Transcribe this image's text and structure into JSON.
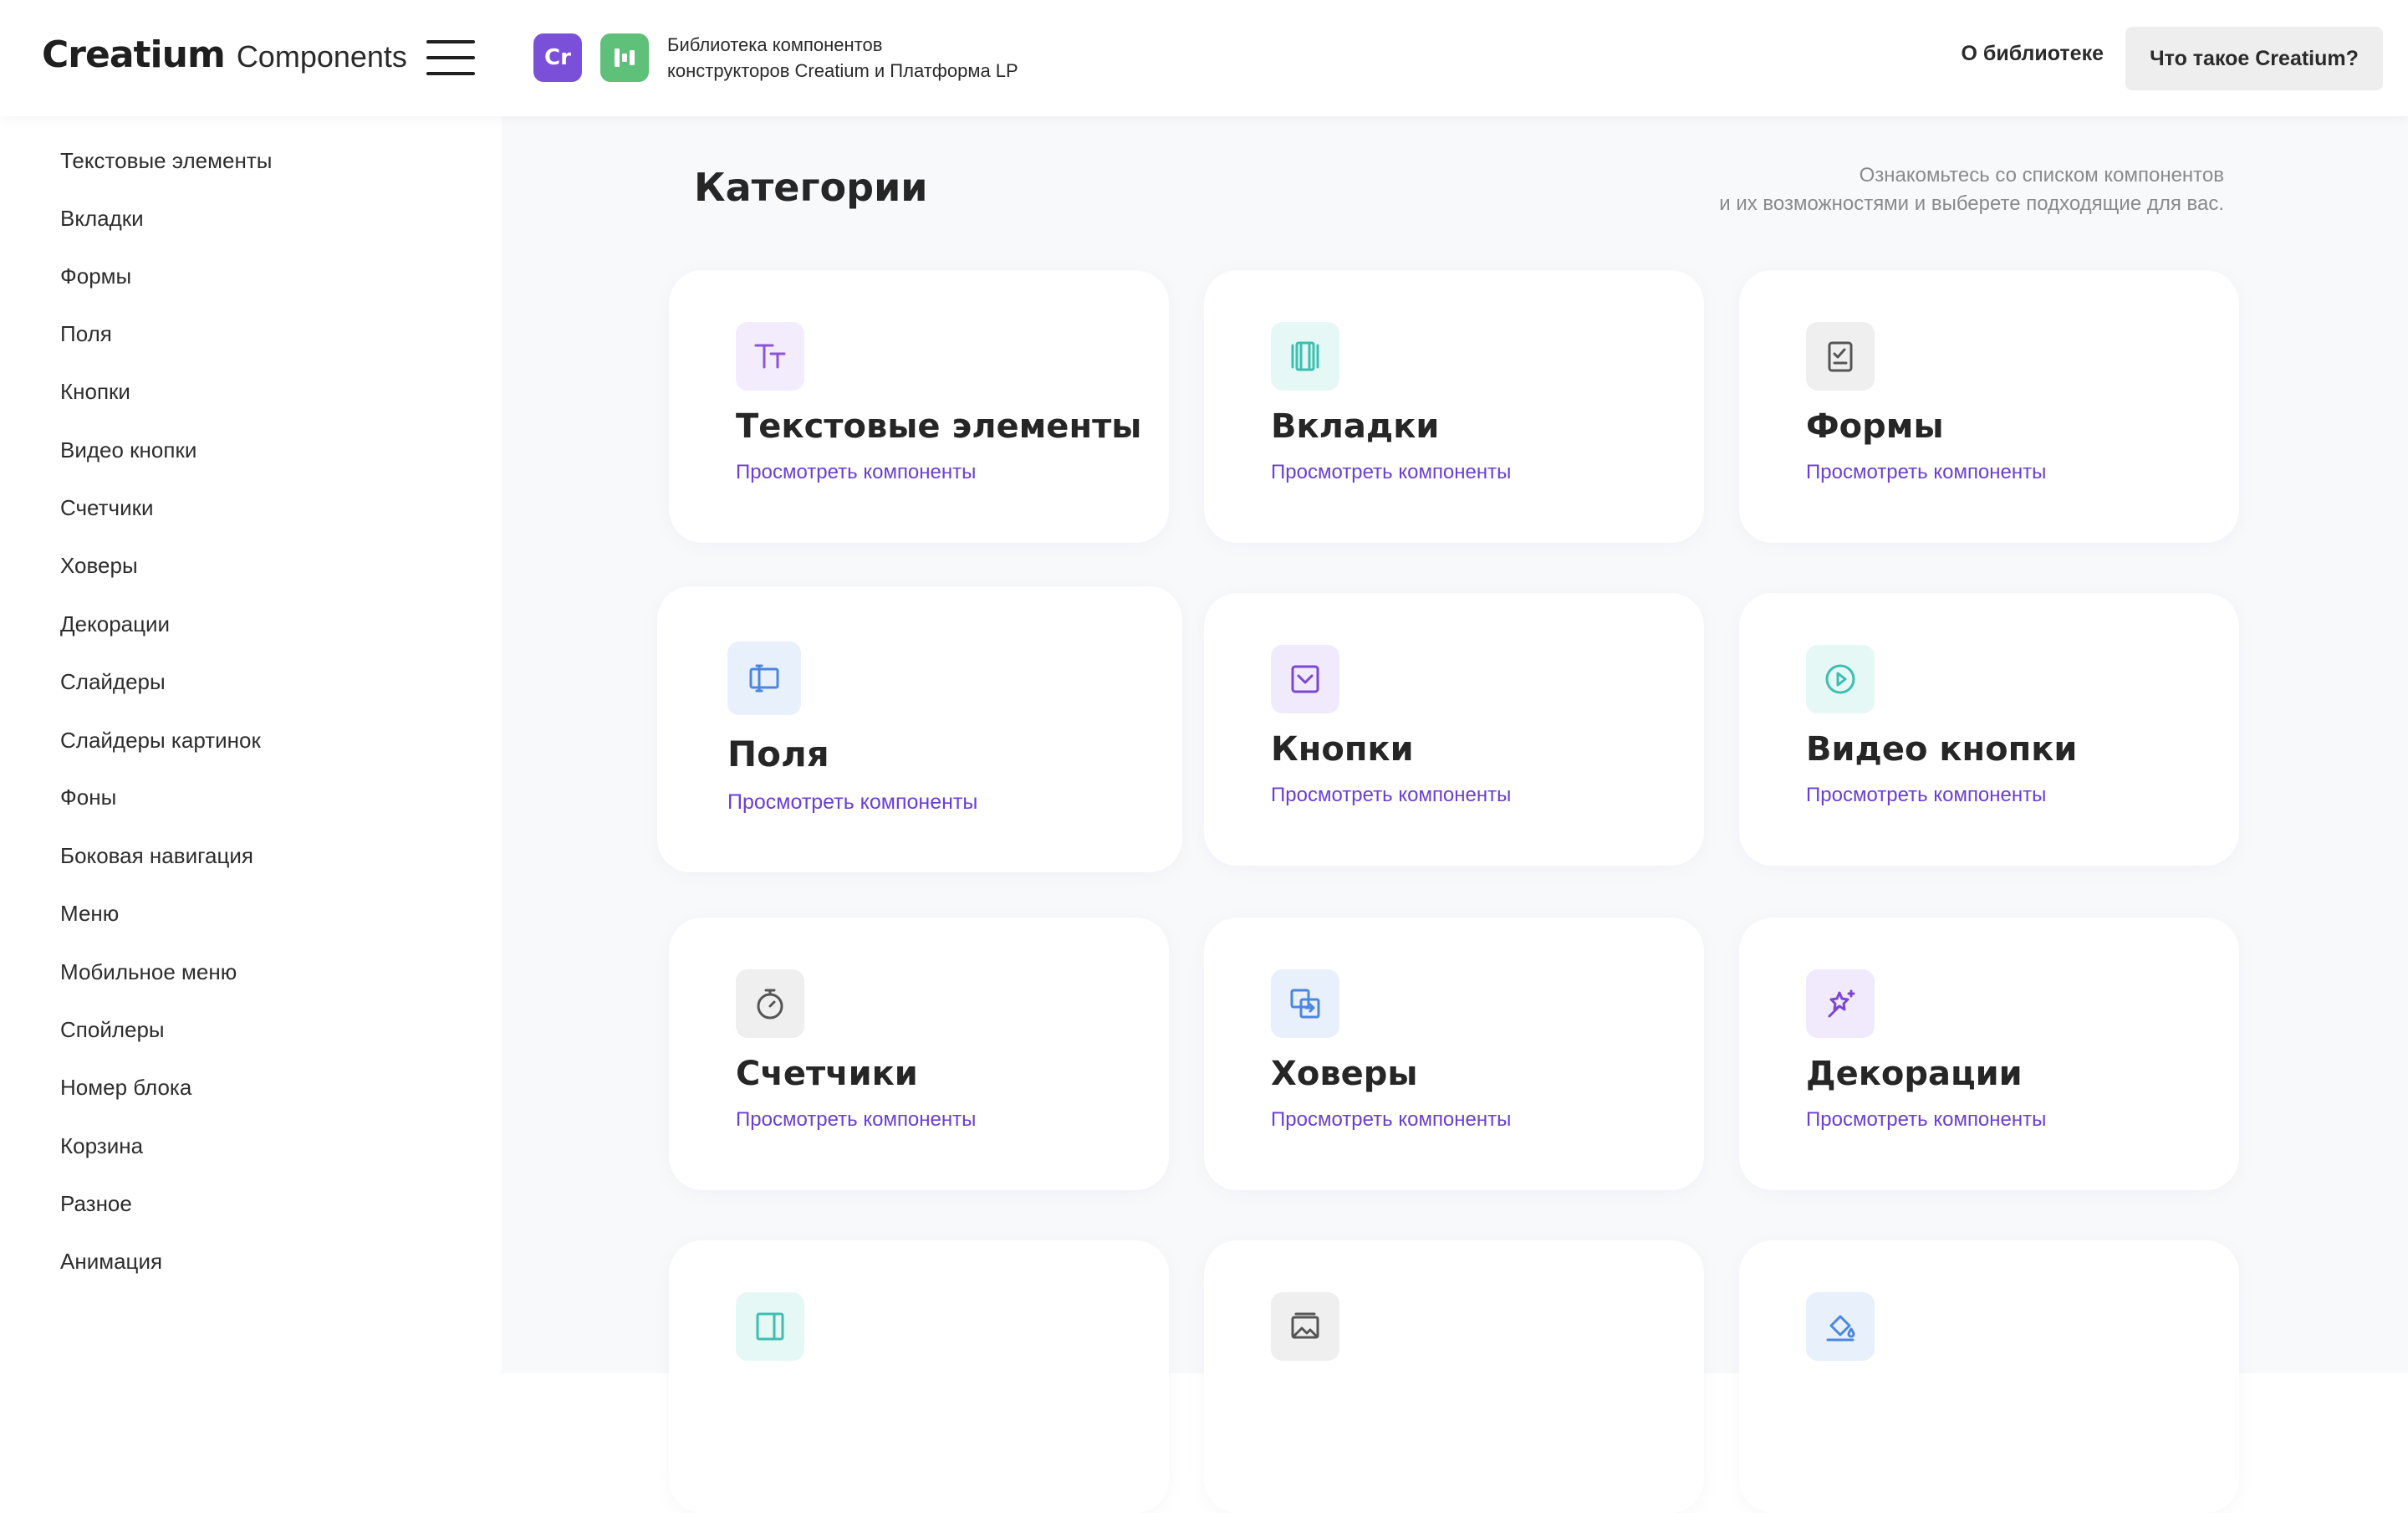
{
  "header": {
    "brand": "Creatium",
    "brand_sub": "Components",
    "badge_cr": "Cr",
    "desc_line1": "Библиотека компонентов",
    "desc_line2": "конструкторов Creatium и Платформа LP",
    "nav_about": "О библиотеке",
    "btn_what": "Что такое Creatium?"
  },
  "sidebar": {
    "items": [
      "Текстовые элементы",
      "Вкладки",
      "Формы",
      "Поля",
      "Кнопки",
      "Видео кнопки",
      "Счетчики",
      "Ховеры",
      "Декорации",
      "Слайдеры",
      "Слайдеры картинок",
      "Фоны",
      "Боковая навигация",
      "Меню",
      "Мобильное меню",
      "Спойлеры",
      "Номер блока",
      "Корзина",
      "Разное",
      "Анимация"
    ]
  },
  "main": {
    "title": "Категории",
    "desc_line1": "Ознакомьтесь со списком компонентов",
    "desc_line2": "и их возможностями и выберете подходящие для вас.",
    "link_label": "Просмотреть компоненты",
    "cards": [
      {
        "title": "Текстовые элементы",
        "icon": "text-icon",
        "icon_color": "#8a55d9",
        "icon_bg": "#f3ecfd"
      },
      {
        "title": "Вкладки",
        "icon": "tabs-icon",
        "icon_color": "#3bbfb0",
        "icon_bg": "#e6f8f5"
      },
      {
        "title": "Формы",
        "icon": "form-icon",
        "icon_color": "#555555",
        "icon_bg": "#efefef"
      },
      {
        "title": "Поля",
        "icon": "field-icon",
        "icon_color": "#4b86e0",
        "icon_bg": "#e8f0fc"
      },
      {
        "title": "Кнопки",
        "icon": "button-icon",
        "icon_color": "#7b45d6",
        "icon_bg": "#f1eafc"
      },
      {
        "title": "Видео кнопки",
        "icon": "play-icon",
        "icon_color": "#3bbfb0",
        "icon_bg": "#e6f8f5"
      },
      {
        "title": "Счетчики",
        "icon": "timer-icon",
        "icon_color": "#555555",
        "icon_bg": "#efefef"
      },
      {
        "title": "Ховеры",
        "icon": "hover-icon",
        "icon_color": "#4b86e0",
        "icon_bg": "#e8f0fc"
      },
      {
        "title": "Декорации",
        "icon": "sparkle-icon",
        "icon_color": "#7b45d6",
        "icon_bg": "#f1eafc"
      },
      {
        "title": "",
        "icon": "slider-icon",
        "icon_color": "#3bbfb0",
        "icon_bg": "#e6f8f5"
      },
      {
        "title": "",
        "icon": "image-icon",
        "icon_color": "#555555",
        "icon_bg": "#efefef"
      },
      {
        "title": "",
        "icon": "paint-bucket-icon",
        "icon_color": "#4b86e0",
        "icon_bg": "#e8f0fc"
      }
    ]
  }
}
